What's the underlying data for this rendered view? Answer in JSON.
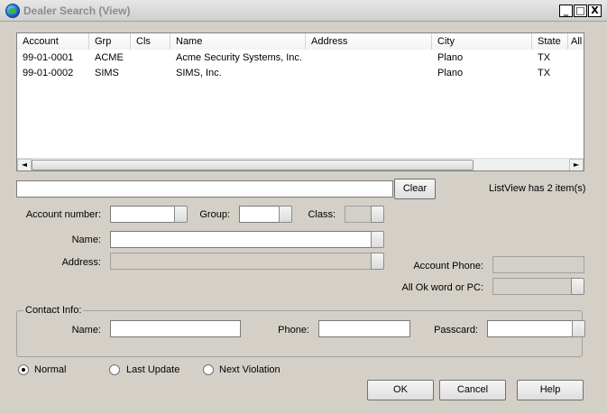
{
  "window": {
    "title": "Dealer Search (View)",
    "controls": {
      "minimize": "_",
      "maximize": "□",
      "close": "X"
    }
  },
  "listview": {
    "columns": [
      "Account",
      "Grp",
      "Cls",
      "Name",
      "Address",
      "City",
      "State",
      "All"
    ],
    "rows": [
      {
        "account": "99-01-0001",
        "grp": "ACME",
        "cls": "",
        "name": "Acme Security Systems, Inc.",
        "address": "",
        "city": "Plano",
        "state": "TX"
      },
      {
        "account": "99-01-0002",
        "grp": "SIMS",
        "cls": "",
        "name": "SIMS, Inc.",
        "address": "",
        "city": "Plano",
        "state": "TX"
      }
    ],
    "scroll_left_glyph": "◄",
    "scroll_right_glyph": "►"
  },
  "search": {
    "value": "",
    "clear_label": "Clear",
    "status": "ListView has 2 item(s)"
  },
  "form": {
    "account_number_label": "Account number:",
    "group_label": "Group:",
    "class_label": "Class:",
    "name_label": "Name:",
    "address_label": "Address:",
    "account_phone_label": "Account Phone:",
    "all_ok_label": "All Ok word or PC:"
  },
  "contact": {
    "group_title": "Contact Info:",
    "name_label": "Name:",
    "phone_label": "Phone:",
    "passcard_label": "Passcard:"
  },
  "mode": {
    "options": [
      "Normal",
      "Last Update",
      "Next Violation"
    ],
    "selected": "Normal"
  },
  "buttons": {
    "ok": "OK",
    "cancel": "Cancel",
    "help": "Help"
  }
}
